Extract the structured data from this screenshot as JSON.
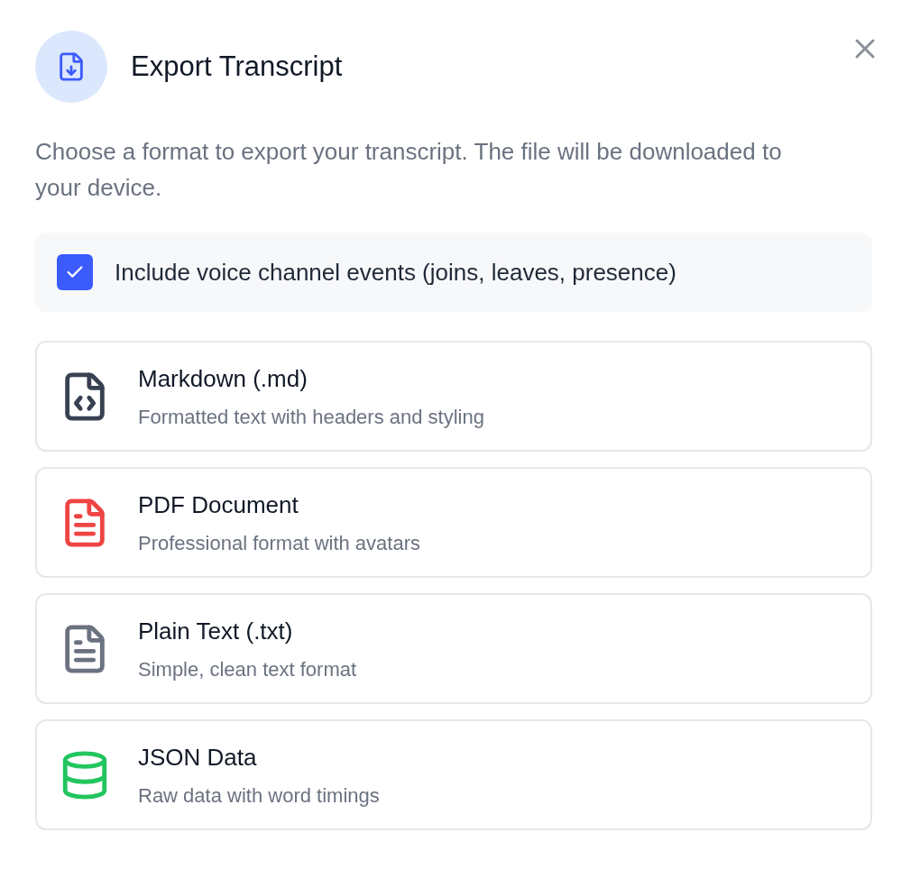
{
  "dialog": {
    "title": "Export Transcript",
    "description": "Choose a format to export your transcript. The file will be downloaded to your device."
  },
  "option": {
    "label": "Include voice channel events (joins, leaves, presence)",
    "checked": true
  },
  "formats": [
    {
      "kind": "code",
      "color": "#374151",
      "title": "Markdown (.md)",
      "subtitle": "Formatted text with headers and styling"
    },
    {
      "kind": "document",
      "color": "#ef4444",
      "title": "PDF Document",
      "subtitle": "Professional format with avatars"
    },
    {
      "kind": "document",
      "color": "#6b7280",
      "title": "Plain Text (.txt)",
      "subtitle": "Simple, clean text format"
    },
    {
      "kind": "database",
      "color": "#22c55e",
      "title": "JSON Data",
      "subtitle": "Raw data with word timings"
    }
  ]
}
